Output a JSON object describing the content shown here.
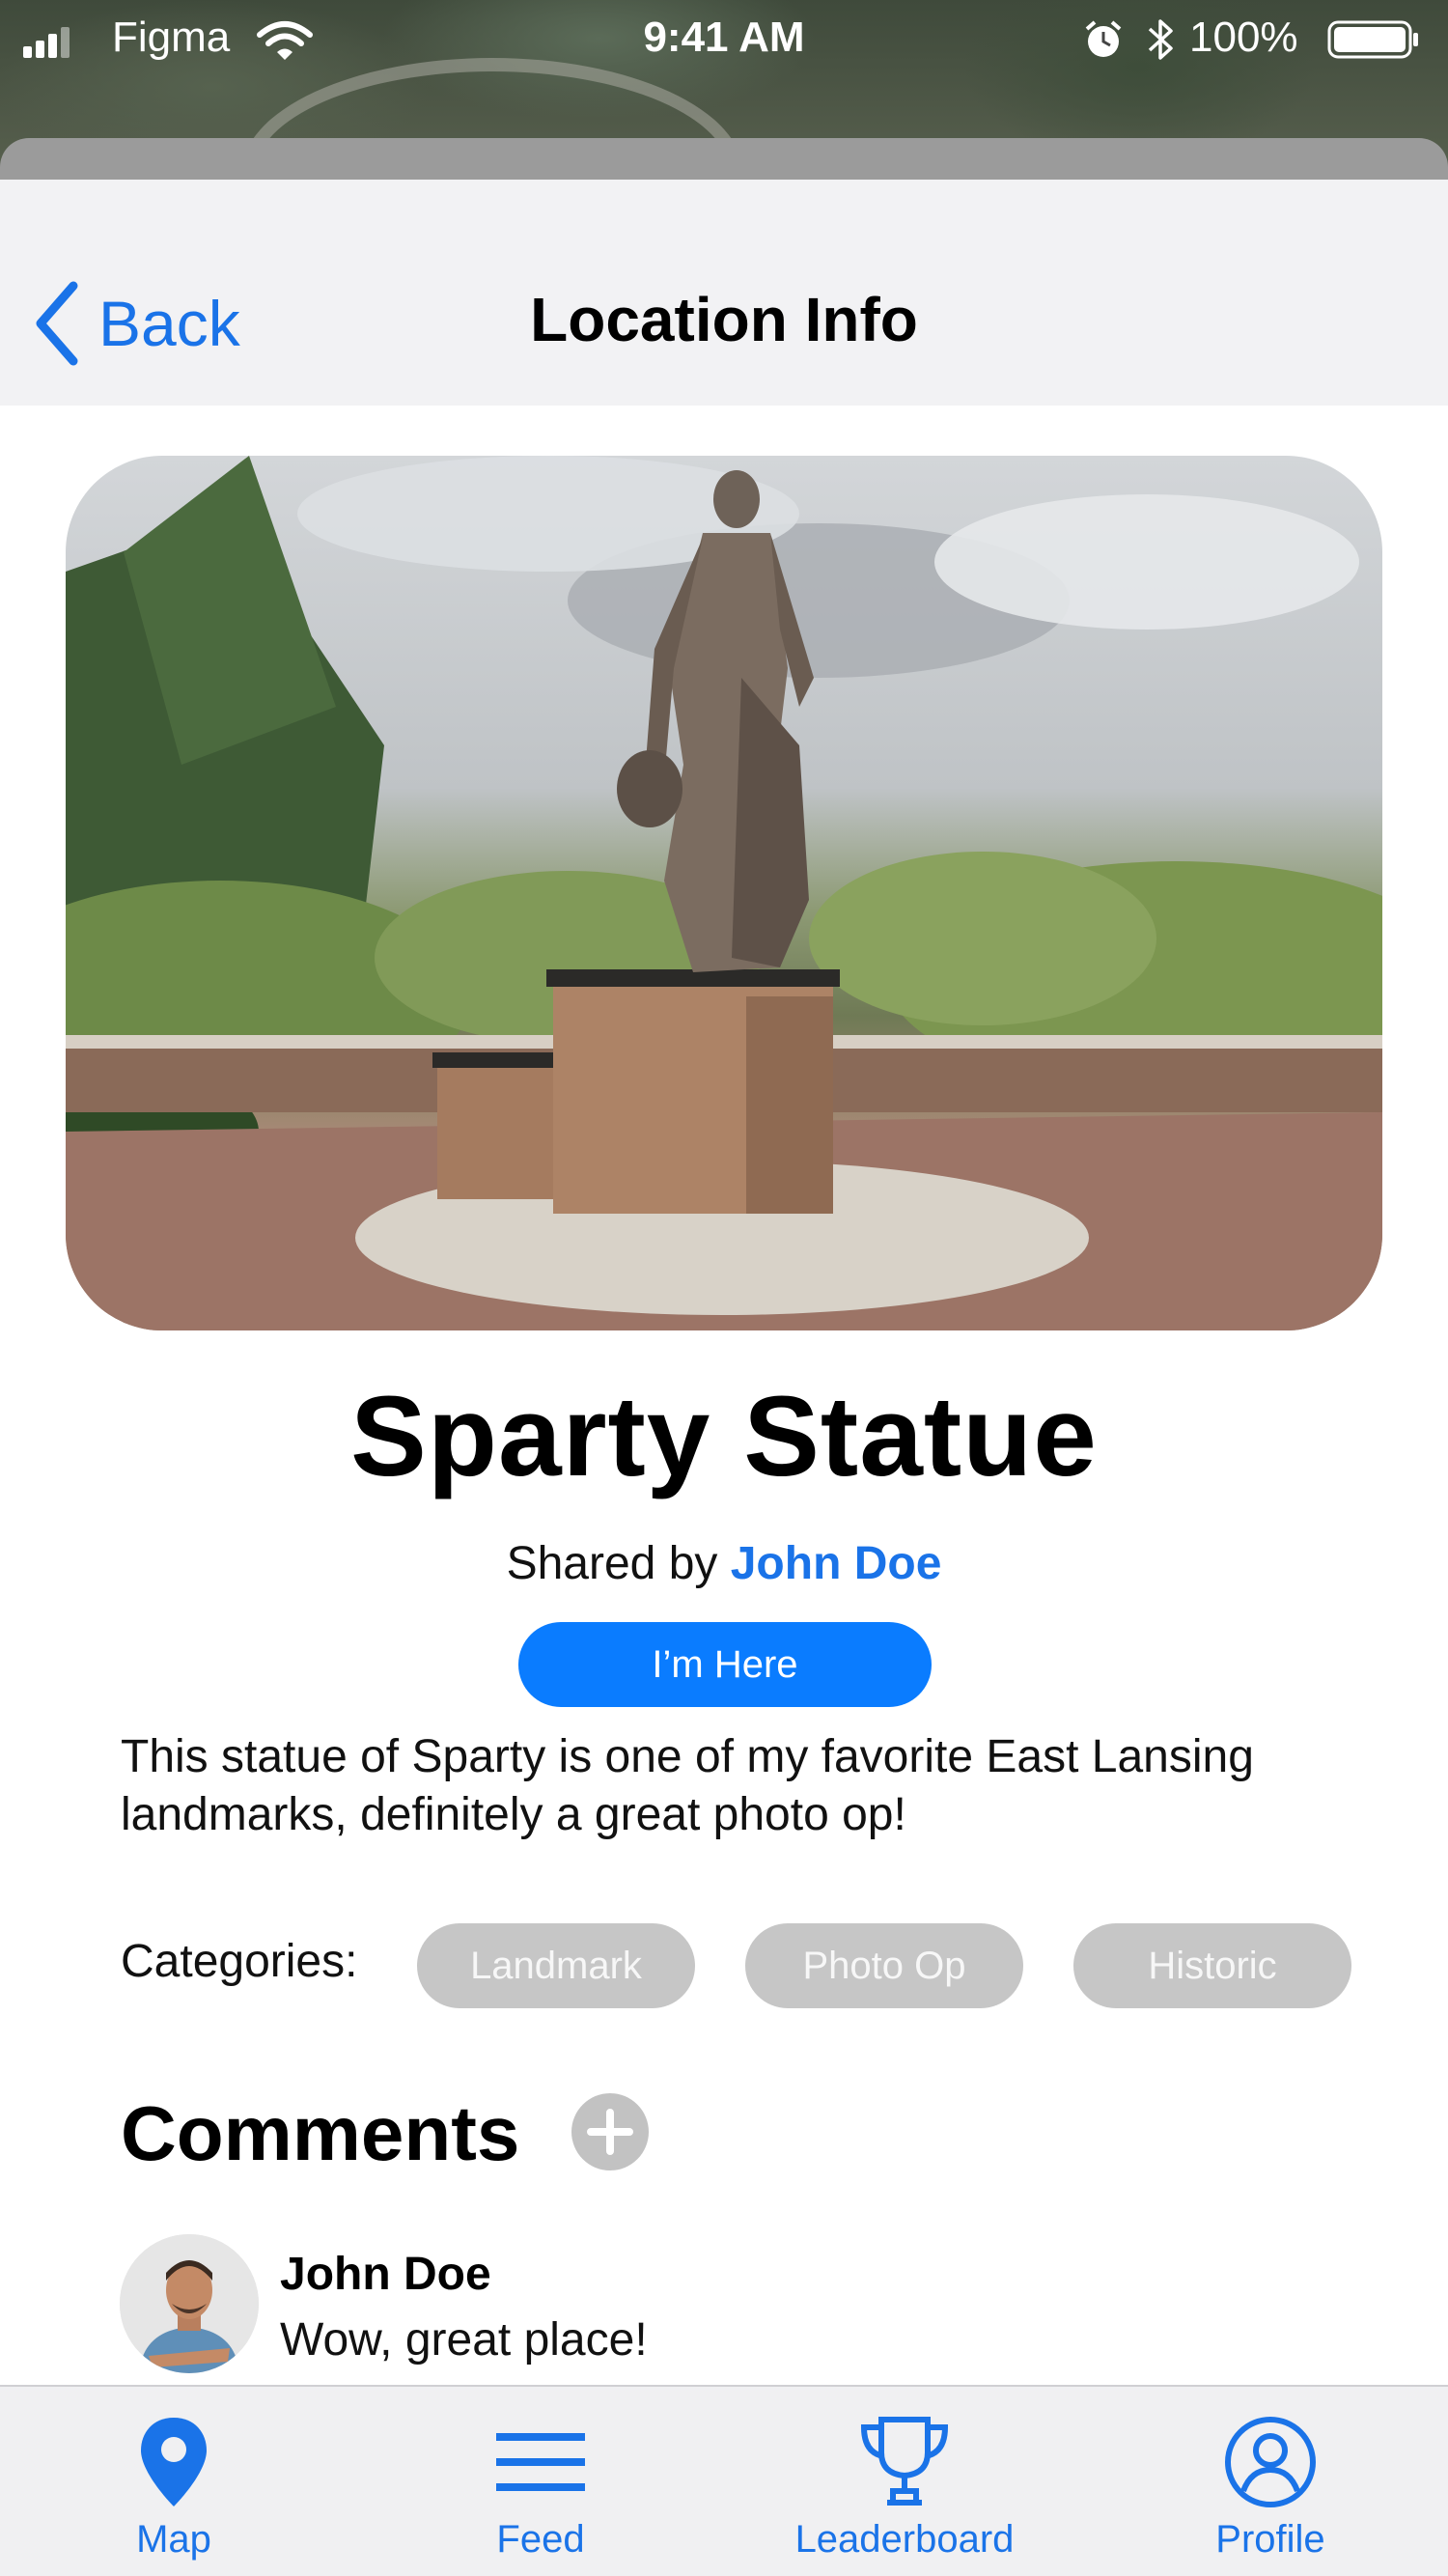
{
  "status_bar": {
    "carrier": "Figma",
    "time": "9:41 AM",
    "battery": "100%"
  },
  "nav": {
    "back_label": "Back",
    "title": "Location Info"
  },
  "location": {
    "name": "Sparty Statue",
    "shared_prefix": "Shared by",
    "shared_by": "John Doe",
    "checkin_label": "I’m Here",
    "description": "This statue of Sparty is one of my favorite East Lansing landmarks, definitely a great photo op!",
    "categories_label": "Categories:",
    "categories": [
      "Landmark",
      "Photo Op",
      "Historic"
    ]
  },
  "comments": {
    "title": "Comments",
    "items": [
      {
        "author": "John Doe",
        "text": "Wow, great place!"
      }
    ]
  },
  "tabbar": {
    "tabs": [
      {
        "label": "Map",
        "icon": "map-pin-icon"
      },
      {
        "label": "Feed",
        "icon": "menu-lines-icon"
      },
      {
        "label": "Leaderboard",
        "icon": "trophy-icon"
      },
      {
        "label": "Profile",
        "icon": "user-circle-icon"
      }
    ]
  },
  "colors": {
    "accent": "#1a73e8",
    "button": "#0a7cff",
    "chip": "#c6c6c6",
    "navbar": "#f2f2f4"
  }
}
